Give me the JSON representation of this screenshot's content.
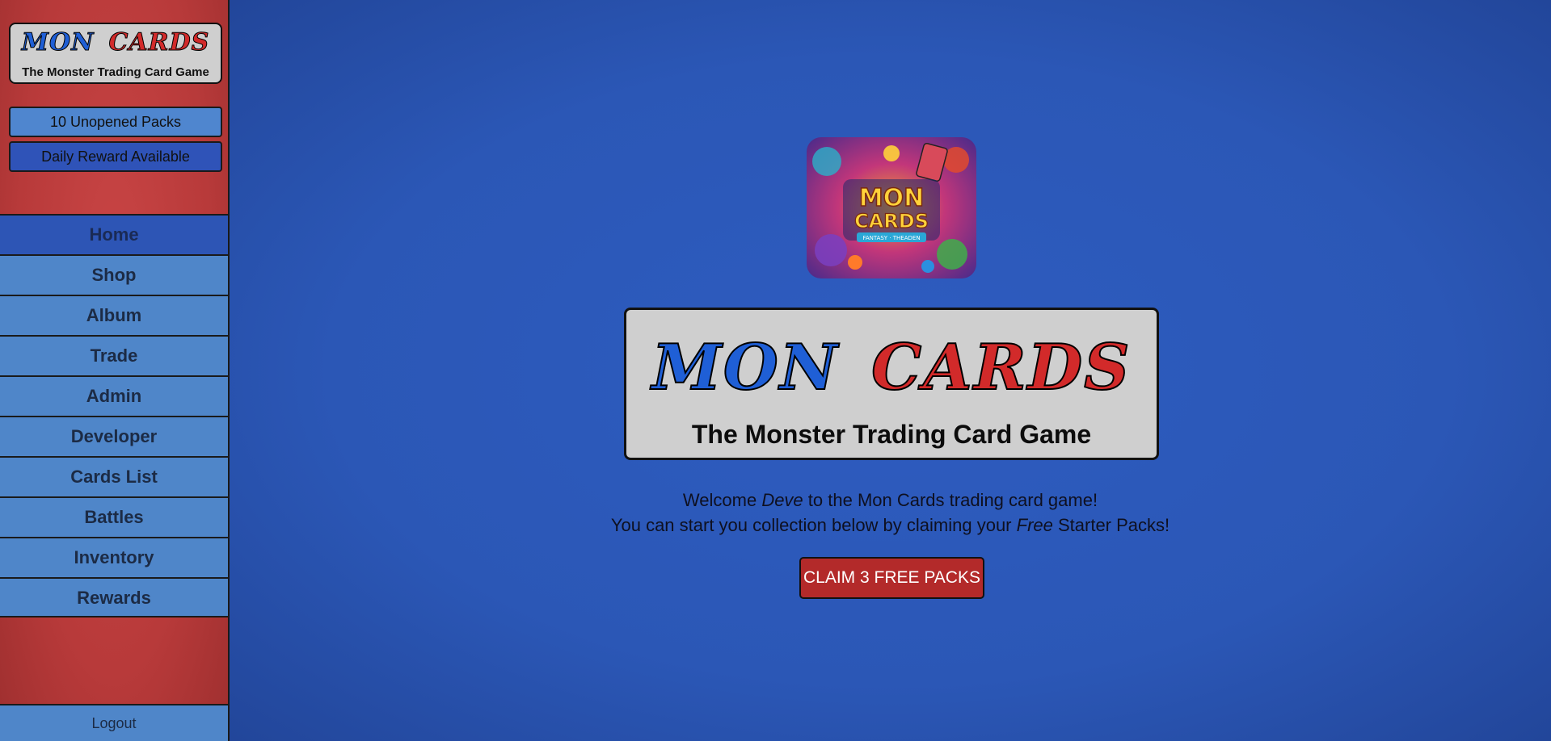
{
  "brand": {
    "logo_word_1": "MON",
    "logo_word_2": "CARDS",
    "tagline": "The Monster Trading Card Game",
    "colors": {
      "blue_word": "#1f5fd6",
      "red_word": "#d22a2a",
      "sidebar": "#b83a3a",
      "main_bg": "#2b58b8"
    }
  },
  "sidebar": {
    "unopened_packs_label": "10 Unopened Packs",
    "daily_reward_label": "Daily Reward Available",
    "nav": [
      {
        "label": "Home",
        "active": true
      },
      {
        "label": "Shop"
      },
      {
        "label": "Album"
      },
      {
        "label": "Trade"
      },
      {
        "label": "Admin"
      },
      {
        "label": "Developer"
      },
      {
        "label": "Cards List"
      },
      {
        "label": "Battles"
      },
      {
        "label": "Inventory"
      },
      {
        "label": "Rewards"
      }
    ],
    "logout_label": "Logout"
  },
  "main": {
    "hero_image": {
      "text_line_1": "MON",
      "text_line_2": "CARDS",
      "ribbon": "FANTASY · THEADEN"
    },
    "welcome_line_1": {
      "prefix": "Welcome ",
      "username": "Deve",
      "suffix": " to the Mon Cards trading card game!"
    },
    "welcome_line_2": {
      "prefix": "You can start you collection below by claiming your ",
      "emphasis": "Free",
      "suffix": " Starter Packs!"
    },
    "claim_button_label": "CLAIM 3 FREE PACKS"
  }
}
